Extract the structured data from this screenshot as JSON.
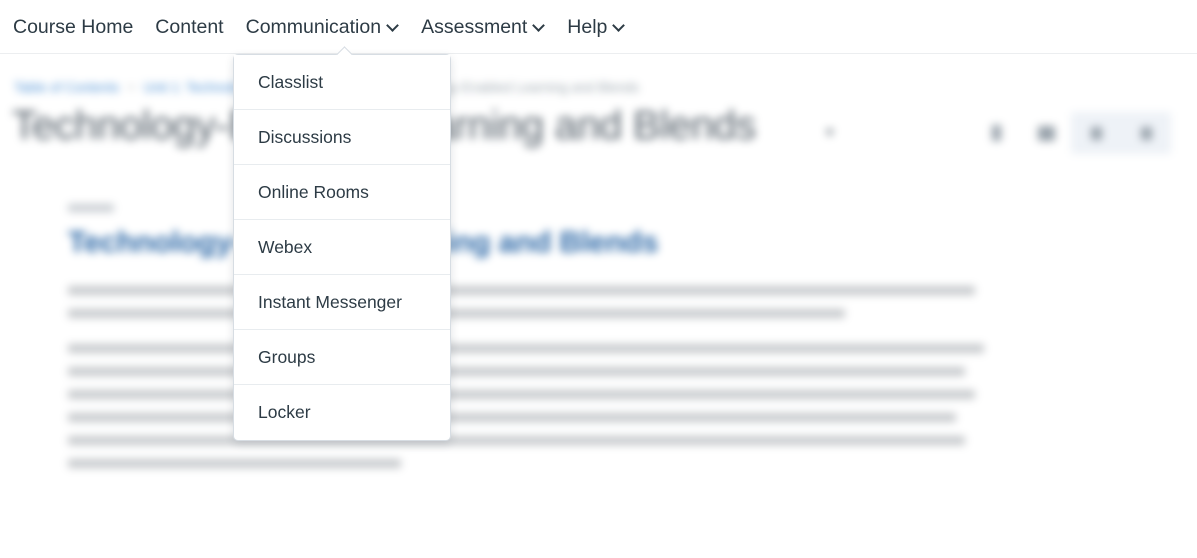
{
  "nav": {
    "items": [
      {
        "label": "Course Home",
        "has_caret": false
      },
      {
        "label": "Content",
        "has_caret": false
      },
      {
        "label": "Communication",
        "has_caret": true
      },
      {
        "label": "Assessment",
        "has_caret": true
      },
      {
        "label": "Help",
        "has_caret": true
      }
    ]
  },
  "dropdown": {
    "owner": "Communication",
    "items": [
      {
        "label": "Classlist"
      },
      {
        "label": "Discussions"
      },
      {
        "label": "Online Rooms"
      },
      {
        "label": "Webex"
      },
      {
        "label": "Instant Messenger"
      },
      {
        "label": "Groups"
      },
      {
        "label": "Locker"
      }
    ]
  },
  "page": {
    "breadcrumb": {
      "table_of_contents": "Table of Contents",
      "unit": "Unit 1: Technology-Enabled Learning",
      "current": "Technology-Enabled Learning and Blends",
      "separator": ">"
    },
    "title": "Technology-Enabled Learning and Blends",
    "title_caret": "▾",
    "content_heading": "Technology-Enabled Learning and Blends",
    "toolbar": [
      {
        "icon": "bookmark-icon",
        "boxed": false
      },
      {
        "icon": "grid-view-icon",
        "boxed": false
      },
      {
        "icon": "previous-arrow-icon",
        "boxed": true
      },
      {
        "icon": "next-arrow-icon",
        "boxed": true
      }
    ],
    "paragraph_1_line_widths": [
      "98%",
      "84%"
    ],
    "paragraph_2_line_widths": [
      "99%",
      "97%",
      "98%",
      "96%",
      "97%",
      "36%"
    ]
  },
  "colors": {
    "nav_text": "#2d3b45",
    "dropdown_border": "#d7dde3",
    "breadcrumb_link": "#4a8fd4",
    "heading_blue": "#2f6aa8",
    "title_gray": "#55606a",
    "body_gray": "#b9bdc1"
  }
}
